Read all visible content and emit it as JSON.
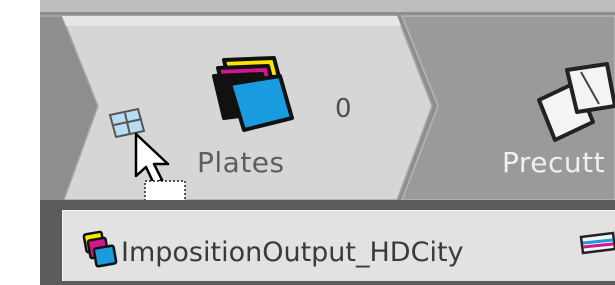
{
  "workflow": {
    "steps": [
      {
        "label": "Plates",
        "count": "0",
        "icon": "plates-icon"
      },
      {
        "label": "Precutt",
        "icon": "precut-icon"
      }
    ]
  },
  "output": {
    "name": "ImpositionOutput_HDCity",
    "icon": "cmyk-plates-icon"
  }
}
